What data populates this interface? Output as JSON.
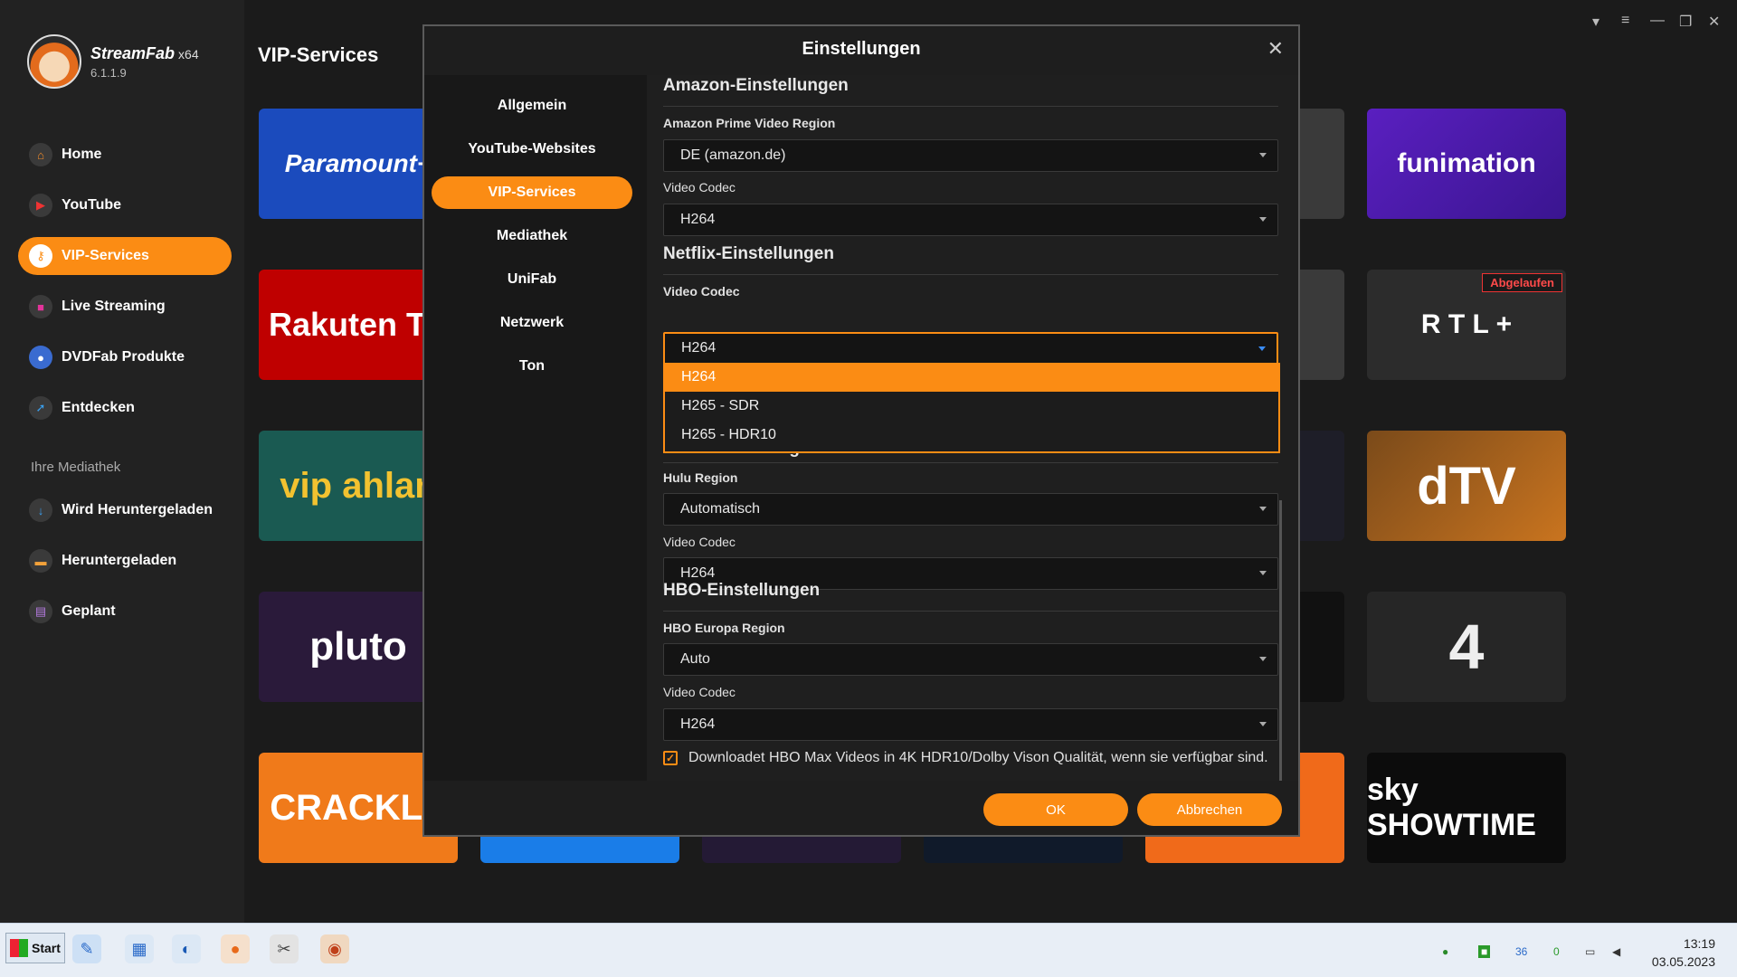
{
  "app": {
    "name": "StreamFab",
    "arch": "x64",
    "version": "6.1.1.9"
  },
  "sidebar": {
    "items": [
      {
        "label": "Home",
        "icon": "home-icon"
      },
      {
        "label": "YouTube",
        "icon": "youtube-icon"
      },
      {
        "label": "VIP-Services",
        "icon": "key-icon"
      },
      {
        "label": "Live Streaming",
        "icon": "camera-icon"
      },
      {
        "label": "DVDFab Produkte",
        "icon": "dvdfab-icon"
      },
      {
        "label": "Entdecken",
        "icon": "compass-icon"
      }
    ],
    "library_label": "Ihre Mediathek",
    "library_items": [
      {
        "label": "Wird Heruntergeladen",
        "icon": "download-arrow-icon"
      },
      {
        "label": "Heruntergeladen",
        "icon": "folder-icon"
      },
      {
        "label": "Geplant",
        "icon": "schedule-icon"
      }
    ]
  },
  "main": {
    "title": "VIP-Services",
    "tiles": [
      {
        "label": "Paramount+",
        "color": "#1b4bbd"
      },
      {
        "label": "Rakuten TV",
        "color": "#bf0000"
      },
      {
        "label": "vip ahlan",
        "color": "#1a5a52"
      },
      {
        "label": "pluto",
        "color": "#2a1a3a"
      },
      {
        "label": "CRACKLE",
        "color": "#f07a1a"
      },
      {
        "label": "funimation",
        "color": "#4b1fa6"
      },
      {
        "label": "R T L +",
        "color": "#2a2a2a",
        "badge": "Abgelaufen"
      },
      {
        "label": "dTV",
        "color": "#b5651d"
      },
      {
        "label": "4",
        "color": "#2a2a2a"
      },
      {
        "label": "sky SHOWTIME",
        "color": "#111111"
      }
    ]
  },
  "dialog": {
    "title": "Einstellungen",
    "nav": [
      "Allgemein",
      "YouTube-Websites",
      "VIP-Services",
      "Mediathek",
      "UniFab",
      "Netzwerk",
      "Ton"
    ],
    "active_nav": "VIP-Services",
    "amazon": {
      "title": "Amazon-Einstellungen",
      "region_label": "Amazon Prime Video Region",
      "region_value": "DE (amazon.de)",
      "codec_label": "Video Codec",
      "codec_value": "H264"
    },
    "netflix": {
      "title": "Netflix-Einstellungen",
      "codec_label": "Video Codec",
      "codec_value": "H264",
      "options": [
        "H264",
        "H265 - SDR",
        "H265 - HDR10"
      ],
      "selected_option": "H264"
    },
    "hulu": {
      "title": "Hulu-Einstellungen",
      "region_label": "Hulu Region",
      "region_value": "Automatisch",
      "codec_label": "Video Codec",
      "codec_value": "H264"
    },
    "hbo": {
      "title": "HBO-Einstellungen",
      "region_label": "HBO Europa Region",
      "region_value": "Auto",
      "codec_label": "Video Codec",
      "codec_value": "H264",
      "checkbox_label": "Downloadet HBO Max Videos in 4K HDR10/Dolby Vison Qualität, wenn sie verfügbar sind.",
      "checkbox_checked": true
    },
    "ok_label": "OK",
    "cancel_label": "Abbrechen"
  },
  "taskbar": {
    "start_label": "Start",
    "tray_numbers": [
      "36",
      "0"
    ],
    "time": "13:19",
    "date": "03.05.2023"
  }
}
